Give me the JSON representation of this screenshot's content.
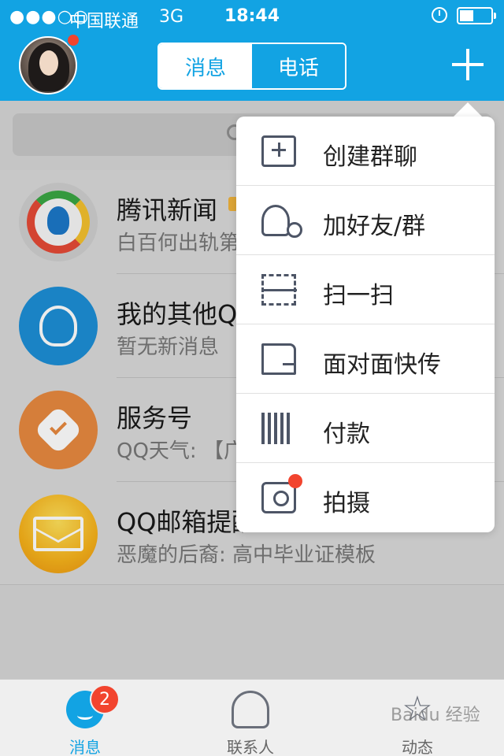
{
  "status_bar": {
    "signal": "●●●○○",
    "carrier": "中国联通",
    "network": "3G",
    "time": "18:44",
    "battery_level_percent": 45
  },
  "header": {
    "tabs": [
      {
        "label": "消息",
        "active": true
      },
      {
        "label": "电话",
        "active": false
      }
    ],
    "avatar_has_badge": true,
    "plus_icon": "plus-icon"
  },
  "search": {
    "icon": "search-icon"
  },
  "conversations": [
    {
      "name": "腾讯新闻",
      "message": "白百何出轨第",
      "icon": "tencent-news-icon"
    },
    {
      "name": "我的其他QQ",
      "message": "暂无新消息",
      "icon": "other-qq-icon"
    },
    {
      "name": "服务号",
      "message": "QQ天气: 【广",
      "icon": "service-account-icon"
    },
    {
      "name": "QQ邮箱提醒",
      "message": "恶魔的后裔: 高中毕业证模板",
      "icon": "qq-mail-icon"
    }
  ],
  "menu": {
    "items": [
      {
        "label": "创建群聊",
        "icon": "create-group-icon"
      },
      {
        "label": "加好友/群",
        "icon": "add-friend-icon"
      },
      {
        "label": "扫一扫",
        "icon": "scan-icon"
      },
      {
        "label": "面对面快传",
        "icon": "face-to-face-transfer-icon"
      },
      {
        "label": "付款",
        "icon": "barcode-payment-icon"
      },
      {
        "label": "拍摄",
        "icon": "camera-icon",
        "has_badge": true
      }
    ]
  },
  "tab_bar": {
    "items": [
      {
        "label": "消息",
        "icon": "message-icon",
        "active": true,
        "badge": "2"
      },
      {
        "label": "联系人",
        "icon": "contacts-icon",
        "active": false
      },
      {
        "label": "动态",
        "icon": "star-icon",
        "active": false
      }
    ]
  },
  "watermark": "Baidu 经验",
  "colors": {
    "brand": "#12a3e3",
    "badge": "#f2442e"
  }
}
